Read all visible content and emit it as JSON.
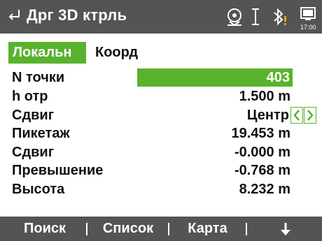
{
  "header": {
    "title": "Дрг 3D ктрль",
    "back_icon": "back-arrow-icon",
    "status_icons": [
      "prism-target-icon",
      "cursor-icon",
      "bluetooth-icon",
      "battery-icon"
    ],
    "time": "17:00"
  },
  "tabs": [
    {
      "label": "Локальн",
      "active": true
    },
    {
      "label": "Коорд",
      "active": false
    }
  ],
  "fields": [
    {
      "label": "N точки",
      "value": "403"
    },
    {
      "label": "h отр",
      "value": "1.500 m"
    },
    {
      "label": "Сдвиг",
      "value": "Центр"
    },
    {
      "label": "Пикетаж",
      "value": "19.453 m"
    },
    {
      "label": "Сдвиг",
      "value": "-0.000 m"
    },
    {
      "label": "Превышение",
      "value": "-0.768 m"
    },
    {
      "label": "Высота",
      "value": "8.232 m"
    }
  ],
  "softkeys": [
    {
      "label": "Поиск"
    },
    {
      "label": "Список"
    },
    {
      "label": "Карта"
    },
    {
      "label": "",
      "icon": "down-arrow-icon"
    }
  ],
  "colors": {
    "titlebar": "#545454",
    "accent_green": "#59b22e",
    "warning_orange": "#f0a020",
    "text": "#111111",
    "background": "#ffffff"
  }
}
